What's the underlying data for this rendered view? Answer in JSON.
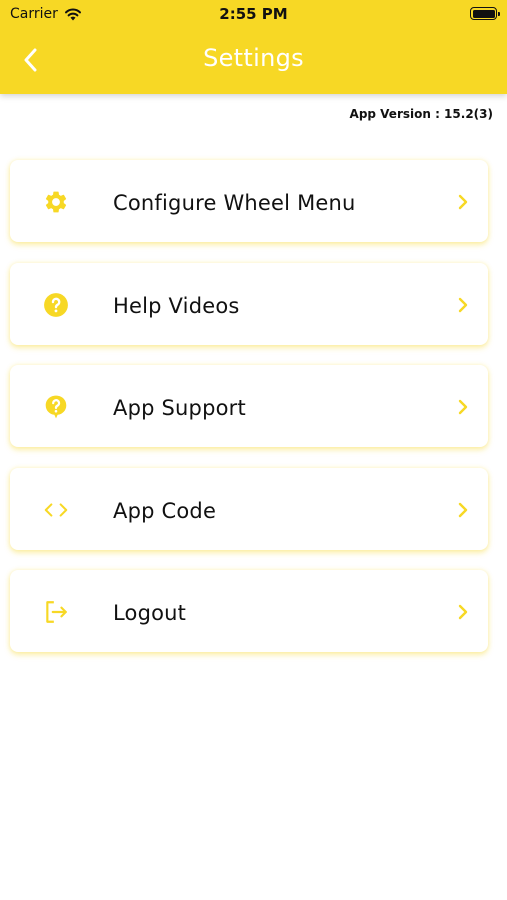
{
  "status_bar": {
    "carrier": "Carrier",
    "time": "2:55 PM"
  },
  "header": {
    "title": "Settings",
    "back_icon": "chevron-left-icon",
    "background": "#F7D825"
  },
  "app_version": "App Version : 15.2(3)",
  "menu": {
    "items": [
      {
        "label": "Configure Wheel Menu",
        "icon": "gear-icon"
      },
      {
        "label": "Help Videos",
        "icon": "question-circle-icon"
      },
      {
        "label": "App Support",
        "icon": "help-bubble-icon"
      },
      {
        "label": "App Code",
        "icon": "code-icon"
      },
      {
        "label": "Logout",
        "icon": "logout-icon"
      }
    ]
  },
  "colors": {
    "accent": "#F7D825",
    "text": "#111111",
    "background": "#FFFFFF"
  }
}
